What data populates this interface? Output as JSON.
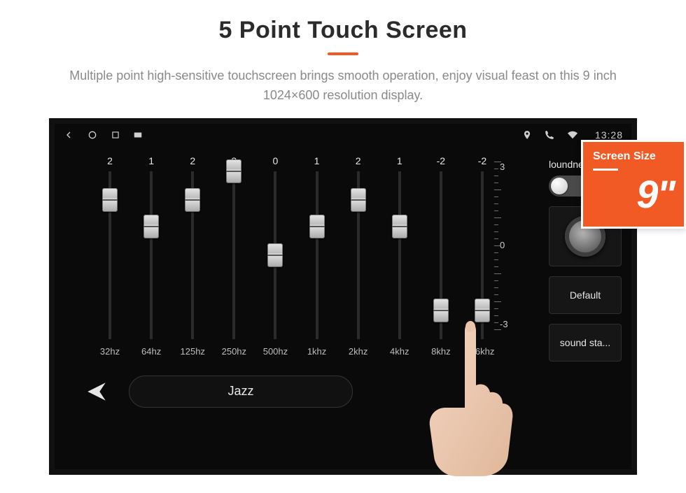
{
  "hero": {
    "title": "5 Point Touch Screen",
    "description": "Multiple point high-sensitive touchscreen brings smooth operation, enjoy visual feast on this 9 inch 1024×600 resolution display."
  },
  "statusbar": {
    "time": "13:28"
  },
  "eq": {
    "sliders": [
      {
        "value": "2",
        "label": "32hz",
        "pos": 83
      },
      {
        "value": "1",
        "label": "64hz",
        "pos": 67
      },
      {
        "value": "2",
        "label": "125hz",
        "pos": 83
      },
      {
        "value": "3",
        "label": "250hz",
        "pos": 100
      },
      {
        "value": "0",
        "label": "500hz",
        "pos": 50
      },
      {
        "value": "1",
        "label": "1khz",
        "pos": 67
      },
      {
        "value": "2",
        "label": "2khz",
        "pos": 83
      },
      {
        "value": "1",
        "label": "4khz",
        "pos": 67
      },
      {
        "value": "-2",
        "label": "8khz",
        "pos": 17
      },
      {
        "value": "-2",
        "label": "16khz",
        "pos": 17
      }
    ],
    "scale": {
      "max": "3",
      "mid": "0",
      "min": "-3"
    },
    "preset": "Jazz"
  },
  "side": {
    "loudness_label": "loundness",
    "default_label": "Default",
    "sound_label": "sound sta..."
  },
  "badge": {
    "title": "Screen Size",
    "value": "9\""
  }
}
